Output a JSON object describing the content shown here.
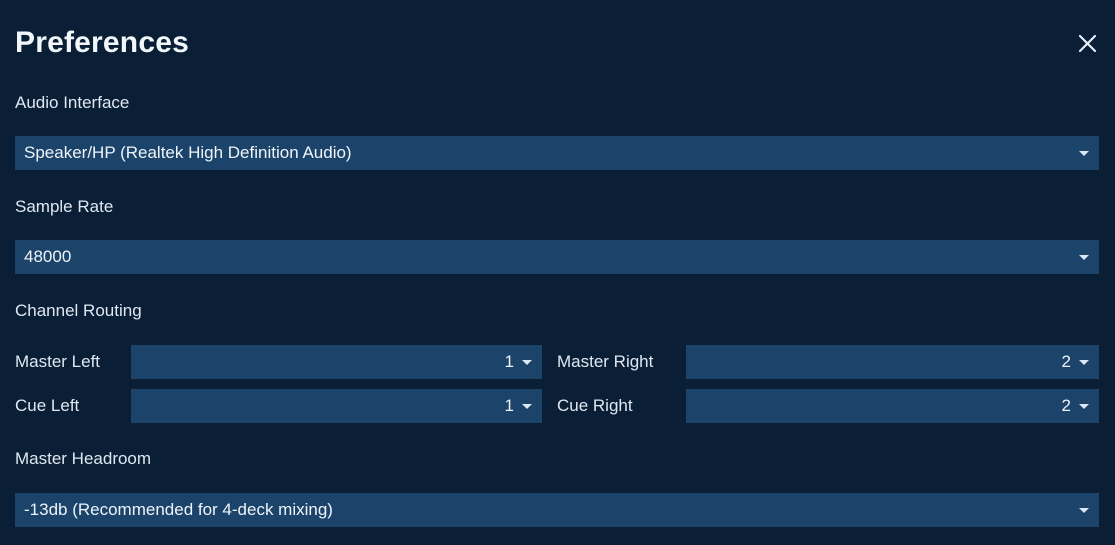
{
  "window": {
    "title": "Preferences",
    "close_icon": "close-icon"
  },
  "colors": {
    "background": "#0a1e35",
    "field": "#1c4369",
    "text": "#e8eff7"
  },
  "fields": {
    "audio_interface": {
      "label": "Audio Interface",
      "value": "Speaker/HP (Realtek High Definition Audio)"
    },
    "sample_rate": {
      "label": "Sample Rate",
      "value": "48000"
    },
    "channel_routing": {
      "label": "Channel Routing",
      "rows": [
        {
          "left_label": "Master Left",
          "left_value": "1",
          "right_label": "Master Right",
          "right_value": "2"
        },
        {
          "left_label": "Cue Left",
          "left_value": "1",
          "right_label": "Cue Right",
          "right_value": "2"
        }
      ]
    },
    "master_headroom": {
      "label": "Master Headroom",
      "value": "-13db (Recommended for 4-deck mixing)"
    }
  }
}
